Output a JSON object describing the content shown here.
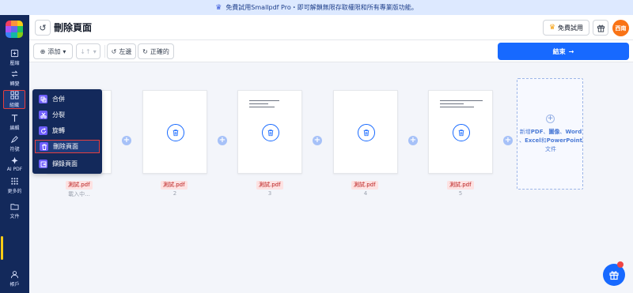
{
  "banner": {
    "text": "免費試用Smallpdf Pro・即可解鎖無限存取權限和所有專業版功能。"
  },
  "sidebar": {
    "items": [
      {
        "label": "壓縮",
        "icon": "compress-icon"
      },
      {
        "label": "轉變",
        "icon": "convert-icon"
      },
      {
        "label": "組織",
        "icon": "organize-icon"
      },
      {
        "label": "編輯",
        "icon": "edit-icon"
      },
      {
        "label": "符號",
        "icon": "sign-icon"
      },
      {
        "label": "AI PDF",
        "icon": "ai-icon"
      },
      {
        "label": "更多的",
        "icon": "more-icon"
      },
      {
        "label": "文件",
        "icon": "folder-icon"
      },
      {
        "label": "帳戶",
        "icon": "account-icon"
      }
    ]
  },
  "header": {
    "title": "刪除頁面",
    "trial_label": "免費試用",
    "avatar_text": "西南"
  },
  "toolbar": {
    "add_label": "添加",
    "rotate_left_label": "左邊",
    "rotate_right_label": "正確的",
    "finish_label": "結束"
  },
  "menu": {
    "items": [
      {
        "label": "合併"
      },
      {
        "label": "分裂"
      },
      {
        "label": "旋轉"
      },
      {
        "label": "刪除頁面"
      },
      {
        "label": "擷錄頁面"
      }
    ]
  },
  "pages": [
    {
      "file": "測試.pdf",
      "caption": "載入中..."
    },
    {
      "file": "測試.pdf",
      "caption": "2"
    },
    {
      "file": "測試.pdf",
      "caption": "3"
    },
    {
      "file": "測試.pdf",
      "caption": "4"
    },
    {
      "file": "測試.pdf",
      "caption": "5"
    }
  ],
  "add_card": {
    "prefix": "新增",
    "pdf": "PDF",
    "sep1": "、",
    "image": "圖像",
    "sep2": "、",
    "word": "Word",
    "sep3": "、",
    "excel": "Excel",
    "and": "和",
    "ppt": "PowerPoint",
    "suffix": "文件"
  },
  "colors": {
    "primary": "#1769ff",
    "sidebar": "#13295b",
    "highlight": "#e53e3e"
  }
}
